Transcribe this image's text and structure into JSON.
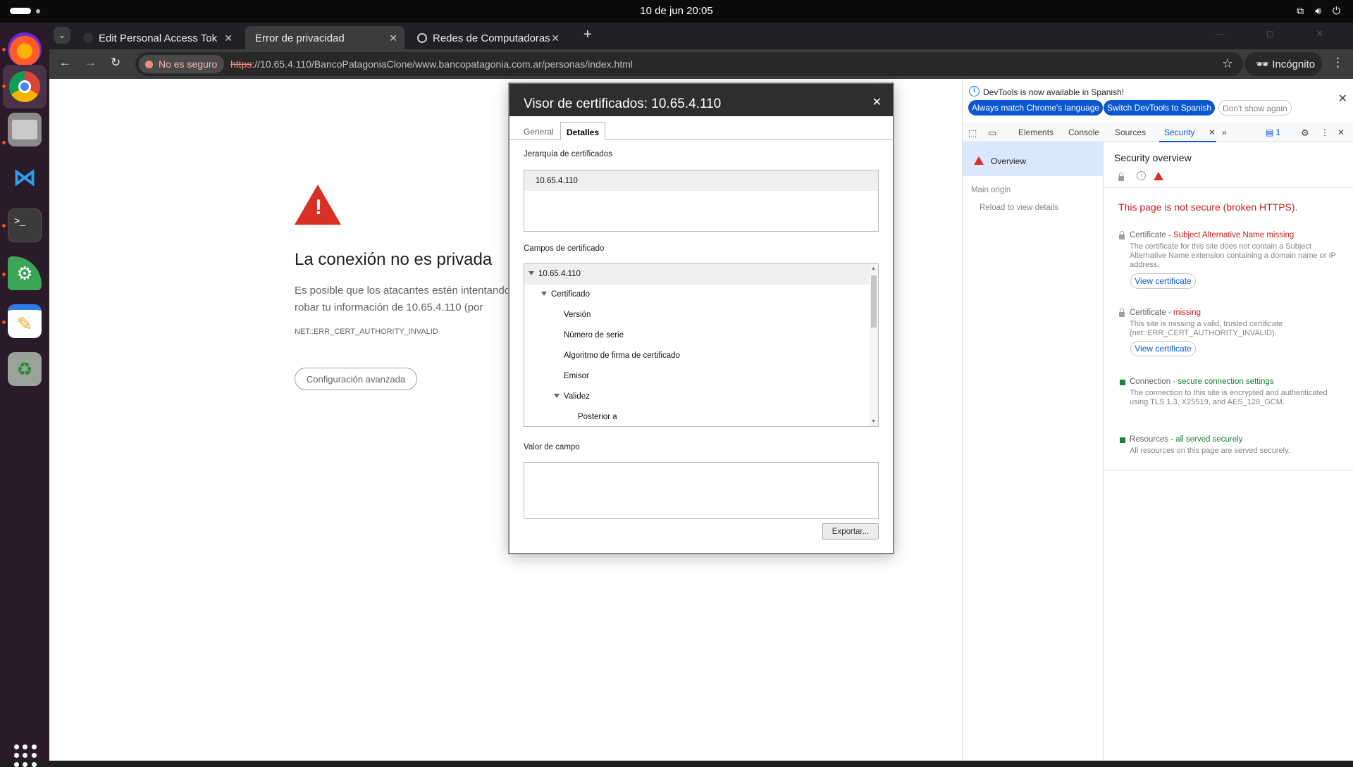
{
  "topbar": {
    "clock": "10 de jun  20:05"
  },
  "dock": {
    "apps": [
      "firefox-icon",
      "chrome-icon",
      "files-icon",
      "vscode-icon",
      "terminal-icon",
      "app-icon",
      "text-editor-icon",
      "trash-icon"
    ]
  },
  "tabs": [
    {
      "label": "Edit Personal Access Tok"
    },
    {
      "label": "Error de privacidad"
    },
    {
      "label": "Redes de Computadoras"
    }
  ],
  "omnibox": {
    "security_chip": "No es seguro",
    "url_scheme": "https",
    "url_rest": "://10.65.4.110/BancoPatagoniaClone/www.bancopatagonia.com.ar/personas/index.html",
    "incognito_label": "Incógnito"
  },
  "error_page": {
    "title": "La conexión no es privada",
    "text": "Es posible que los atacantes estén intentando robar tu información de 10.65.4.110 (por ejemplo, contraseñas, mensajes o tarjetas de crédito).",
    "code": "NET::ERR_CERT_AUTHORITY_INVALID",
    "advanced_button": "Configuración avanzada"
  },
  "cert_dialog": {
    "title": "Visor de certificados: 10.65.4.110",
    "tabs": [
      "General",
      "Detalles"
    ],
    "hierarchy_label": "Jerarquía de certificados",
    "hierarchy": [
      "10.65.4.110"
    ],
    "fields_label": "Campos de certificado",
    "fields": [
      {
        "label": "10.65.4.110",
        "level": 0,
        "expanded": true
      },
      {
        "label": "Certificado",
        "level": 1,
        "expanded": true
      },
      {
        "label": "Versión",
        "level": 2
      },
      {
        "label": "Número de serie",
        "level": 2
      },
      {
        "label": "Algoritmo de firma de certificado",
        "level": 2
      },
      {
        "label": "Emisor",
        "level": 2
      },
      {
        "label": "Validez",
        "level": 2,
        "expanded": true
      },
      {
        "label": "Posterior a",
        "level": 3
      }
    ],
    "value_label": "Valor de campo",
    "export_button": "Exportar..."
  },
  "devtools": {
    "info_text": "DevTools is now available in Spanish!",
    "btn_match": "Always match Chrome's language",
    "btn_switch": "Switch DevTools to Spanish",
    "btn_dont": "Don't show again",
    "tabs": [
      "Elements",
      "Console",
      "Sources",
      "Security"
    ],
    "issues_count": "1",
    "sidebar": {
      "overview": "Overview",
      "main_origin": "Main origin",
      "reload": "Reload to view details"
    },
    "heading": "Security overview",
    "not_secure": "This page is not secure (broken HTTPS).",
    "sections": [
      {
        "prefix": "Certificate - ",
        "status": "Subject Alternative Name missing",
        "desc": "The certificate for this site does not contain a Subject Alternative Name extension containing a domain name or IP address.",
        "button": "View certificate"
      },
      {
        "prefix": "Certificate - ",
        "status": "missing",
        "desc": "This site is missing a valid, trusted certificate (net::ERR_CERT_AUTHORITY_INVALID).",
        "button": "View certificate"
      },
      {
        "prefix": "Connection - ",
        "status": "secure connection settings",
        "desc": "The connection to this site is encrypted and authenticated using TLS 1.3, X25519, and AES_128_GCM."
      },
      {
        "prefix": "Resources - ",
        "status": "all served securely",
        "desc": "All resources on this page are served securely."
      }
    ]
  }
}
